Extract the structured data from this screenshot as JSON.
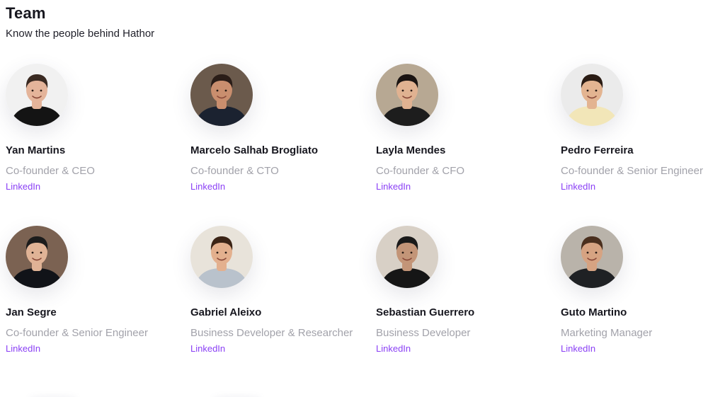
{
  "header": {
    "title": "Team",
    "subtitle": "Know the people behind Hathor"
  },
  "members": [
    {
      "name": "Yan Martins",
      "role": "Co-founder & CEO",
      "link": "LinkedIn",
      "avatar": {
        "bg": "#f1f1f1",
        "skin": "#e4b49a",
        "hair": "#3a2a22",
        "shirt": "#141414"
      }
    },
    {
      "name": "Marcelo Salhab Brogliato",
      "role": "Co-founder & CTO",
      "link": "LinkedIn",
      "avatar": {
        "bg": "#6b5a4c",
        "skin": "#c98e6e",
        "hair": "#2a1d18",
        "shirt": "#1b2230"
      }
    },
    {
      "name": "Layla Mendes",
      "role": "Co-founder & CFO",
      "link": "LinkedIn",
      "avatar": {
        "bg": "#b7a893",
        "skin": "#e0b291",
        "hair": "#1a1412",
        "shirt": "#1d1d1d"
      }
    },
    {
      "name": "Pedro Ferreira",
      "role": "Co-founder & Senior Engineer",
      "link": "LinkedIn",
      "avatar": {
        "bg": "#ebebeb",
        "skin": "#e3b491",
        "hair": "#2a1c14",
        "shirt": "#f2e6b8"
      }
    },
    {
      "name": "Jan Segre",
      "role": "Co-founder & Senior Engineer",
      "link": "LinkedIn",
      "avatar": {
        "bg": "#7b6252",
        "skin": "#e0b396",
        "hair": "#1c1c1c",
        "shirt": "#111318"
      }
    },
    {
      "name": "Gabriel Aleixo",
      "role": "Business Developer & Researcher",
      "link": "LinkedIn",
      "avatar": {
        "bg": "#e8e3da",
        "skin": "#e3b08e",
        "hair": "#3b2416",
        "shirt": "#b9c2cc"
      }
    },
    {
      "name": "Sebastian Guerrero",
      "role": "Business Developer",
      "link": "LinkedIn",
      "avatar": {
        "bg": "#d8d0c6",
        "skin": "#c39578",
        "hair": "#1a1a1a",
        "shirt": "#161616"
      }
    },
    {
      "name": "Guto Martino",
      "role": "Marketing Manager",
      "link": "LinkedIn",
      "avatar": {
        "bg": "#b9b3aa",
        "skin": "#d6a382",
        "hair": "#4a2f1e",
        "shirt": "#1f2124"
      }
    }
  ]
}
